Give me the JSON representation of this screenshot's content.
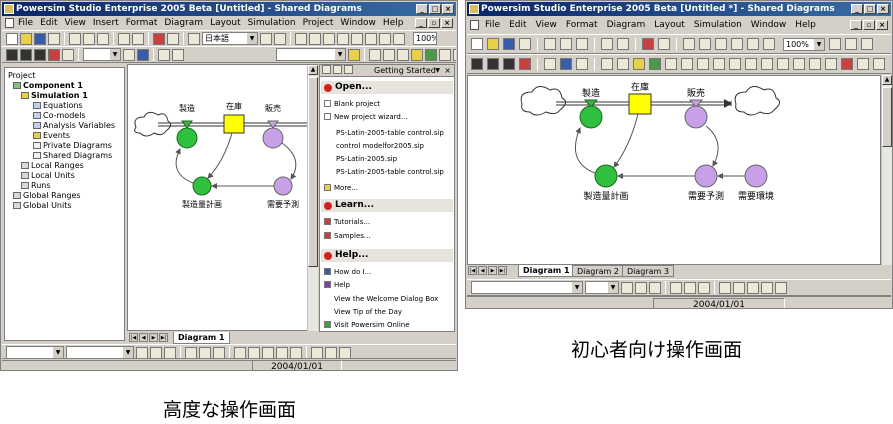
{
  "left_window": {
    "title": "Powersim Studio Enterprise 2005 Beta [Untitled] - Shared Diagrams",
    "menu": [
      "File",
      "Edit",
      "View",
      "Insert",
      "Format",
      "Diagram",
      "Layout",
      "Simulation",
      "Project",
      "Window",
      "Help"
    ],
    "language_select": "日本語",
    "zoom": "100%",
    "tree": {
      "project": "Project",
      "component": "Component 1",
      "simulation": "Simulation 1",
      "items": [
        "Equations",
        "Co-models",
        "Analysis Variables",
        "Events",
        "Private Diagrams",
        "Shared Diagrams"
      ],
      "local": [
        "Local Ranges",
        "Local Units",
        "Runs"
      ],
      "global": [
        "Global Ranges",
        "Global Units"
      ]
    },
    "diagram": {
      "stock": "在庫",
      "flow_in": "製造",
      "flow_out": "販売",
      "plan": "製造量計画",
      "forecast": "需要予測"
    },
    "panel": {
      "header": "Getting Started",
      "open_title": "Open...",
      "open_items": [
        "Blank project",
        "New project wizard...",
        "PS-Latin-2005-table control.sip",
        "control modelfor2005.sip",
        "PS-Latin-2005.sip",
        "PS-Latin-2005-table control.sip"
      ],
      "more": "More...",
      "learn_title": "Learn...",
      "learn_items": [
        "Tutorials...",
        "Samples..."
      ],
      "help_title": "Help...",
      "help_items": [
        "How do I...",
        "Help",
        "View the Welcome Dialog Box",
        "View Tip of the Day",
        "Visit Powersim Online"
      ]
    },
    "tab": "Diagram 1",
    "status_date": "2004/01/01"
  },
  "right_window": {
    "title": "Powersim Studio Enterprise 2005 Beta [Untitled *] - Shared Diagrams",
    "menu": [
      "File",
      "Edit",
      "View",
      "Format",
      "Diagram",
      "Layout",
      "Simulation",
      "Window",
      "Help"
    ],
    "zoom": "100%",
    "diagram": {
      "stock": "在庫",
      "flow_in": "製造",
      "flow_out": "販売",
      "plan": "製造量計画",
      "forecast": "需要予測",
      "environment": "需要環境"
    },
    "tabs": [
      "Diagram 1",
      "Diagram 2",
      "Diagram 3"
    ],
    "status_date": "2004/01/01"
  },
  "captions": {
    "left": "高度な操作画面",
    "right": "初心者向け操作画面"
  }
}
